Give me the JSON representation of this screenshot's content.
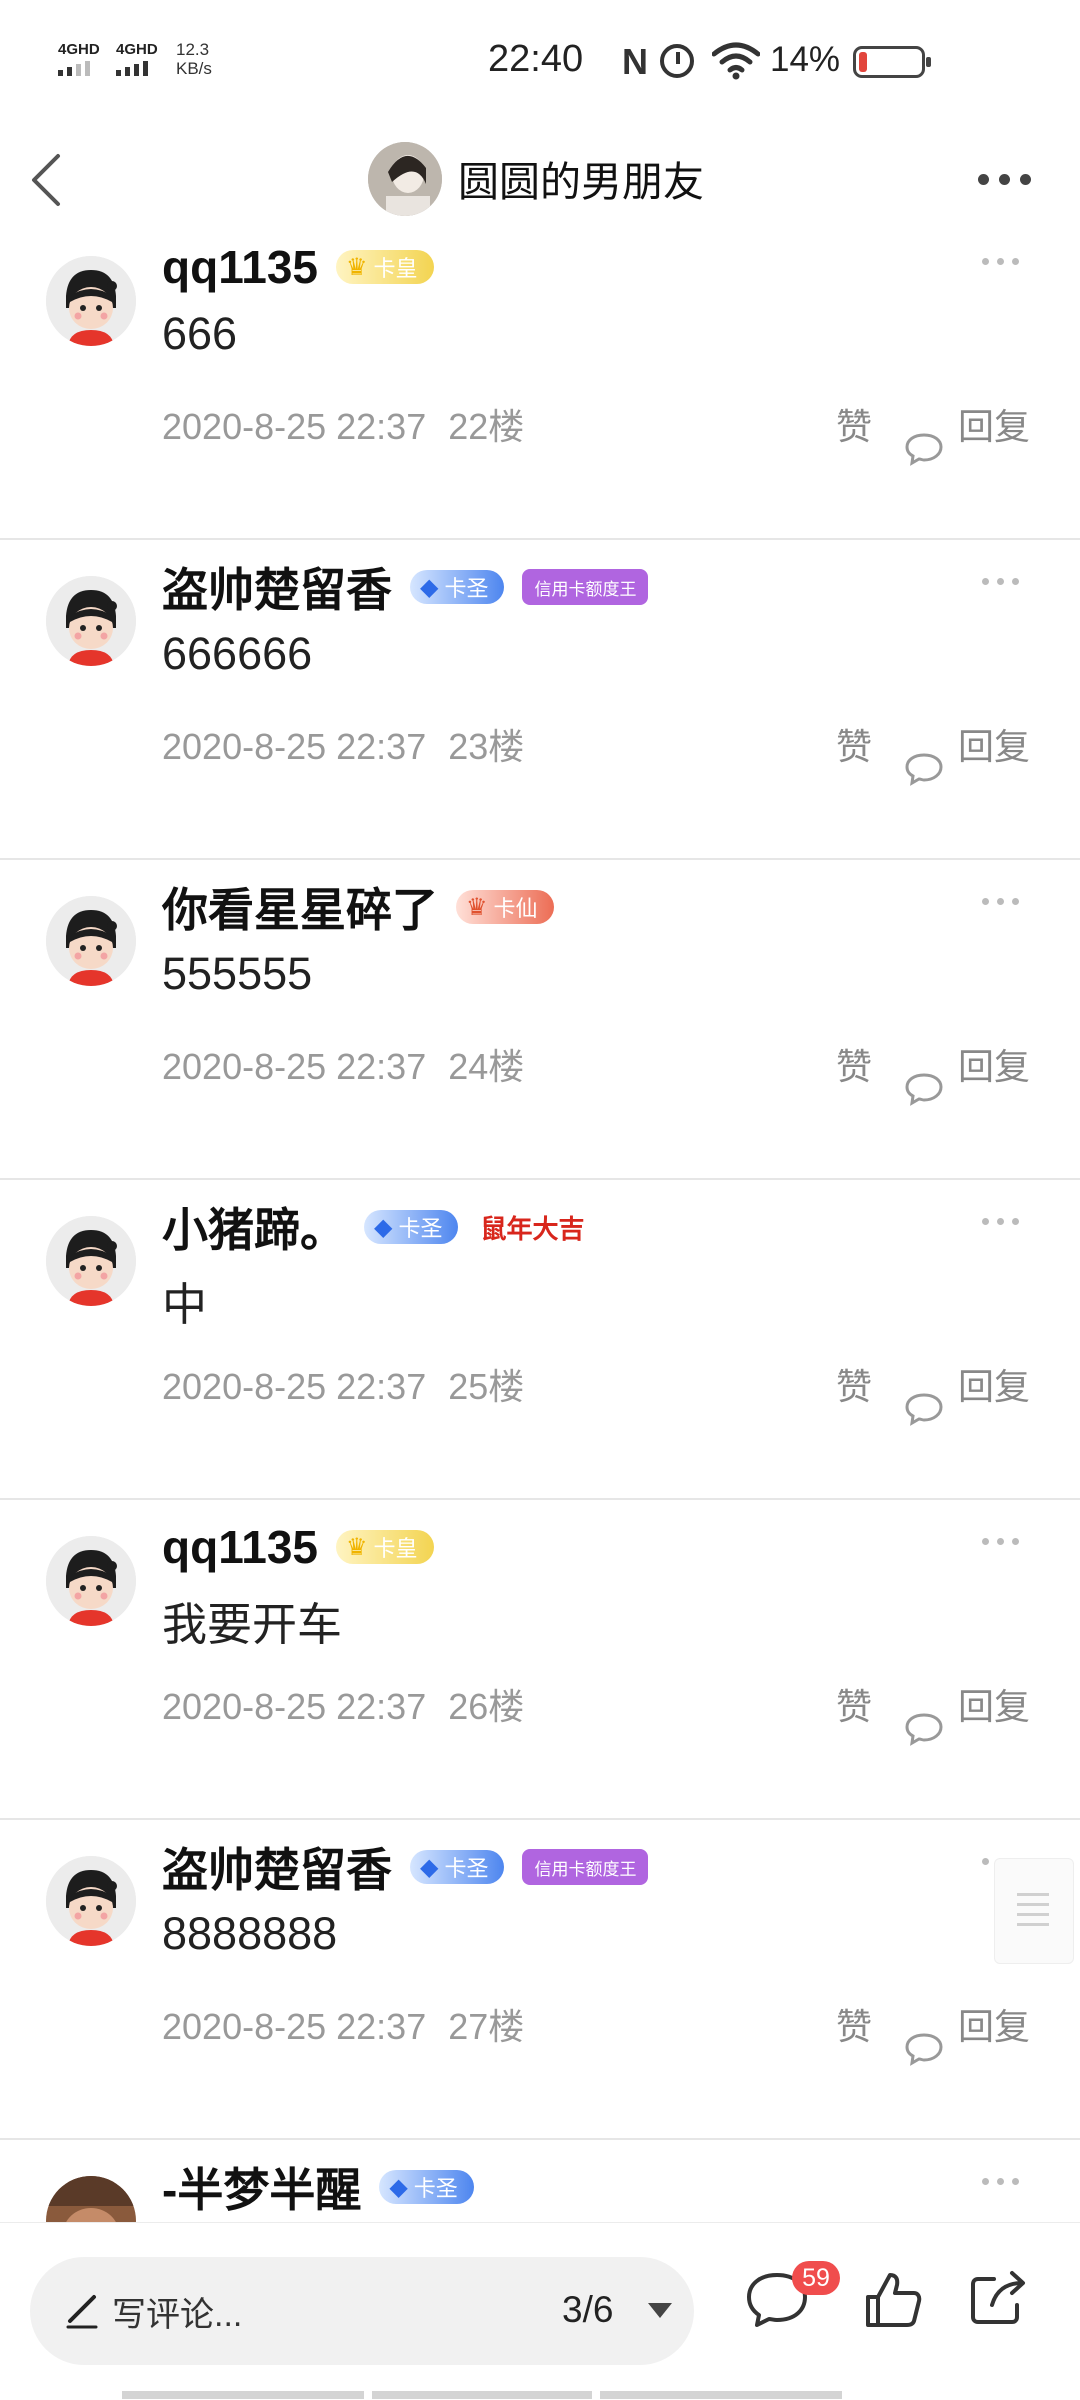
{
  "status_bar": {
    "sim1": "4GHD",
    "sim2": "4GHD",
    "net_speed_value": "12.3",
    "net_speed_unit": "KB/s",
    "time": "22:40",
    "battery": "14%",
    "battery_level": 0.14,
    "icons": [
      "nfc-icon",
      "alarm-icon",
      "wifi-icon",
      "battery-icon"
    ]
  },
  "header": {
    "back_icon": "chevron-left-icon",
    "title": "圆圆的男朋友",
    "more_icon": "more-dots-icon"
  },
  "comments": [
    {
      "name": "qq1135",
      "badges": [
        {
          "type": "gold",
          "icon": "♛",
          "label": "卡皇"
        }
      ],
      "text": "666",
      "date": "2020-8-25 22:37",
      "floor": "22楼",
      "avatar": "cartoon"
    },
    {
      "name": "盗帅楚留香",
      "badges": [
        {
          "type": "blue",
          "icon": "◆",
          "label": "卡圣"
        },
        {
          "type": "purple",
          "icon": "",
          "label": "信用卡额度王"
        }
      ],
      "text": "666666",
      "date": "2020-8-25 22:37",
      "floor": "23楼",
      "avatar": "cartoon"
    },
    {
      "name": "你看星星碎了",
      "badges": [
        {
          "type": "red",
          "icon": "♛",
          "label": "卡仙"
        }
      ],
      "text": "555555",
      "date": "2020-8-25 22:37",
      "floor": "24楼",
      "avatar": "cartoon"
    },
    {
      "name": "小猪蹄。",
      "badges": [
        {
          "type": "blue",
          "icon": "◆",
          "label": "卡圣"
        },
        {
          "type": "newyear",
          "icon": "",
          "label": "鼠年大吉"
        }
      ],
      "text": "中",
      "date": "2020-8-25 22:37",
      "floor": "25楼",
      "avatar": "cartoon"
    },
    {
      "name": "qq1135",
      "badges": [
        {
          "type": "gold",
          "icon": "♛",
          "label": "卡皇"
        }
      ],
      "text": "我要开车",
      "date": "2020-8-25 22:37",
      "floor": "26楼",
      "avatar": "cartoon"
    },
    {
      "name": "盗帅楚留香",
      "badges": [
        {
          "type": "blue",
          "icon": "◆",
          "label": "卡圣"
        },
        {
          "type": "purple",
          "icon": "",
          "label": "信用卡额度王"
        }
      ],
      "text": "8888888",
      "date": "2020-8-25 22:37",
      "floor": "27楼",
      "avatar": "cartoon"
    },
    {
      "name": "-半梦半醒",
      "badges": [
        {
          "type": "blue",
          "icon": "◆",
          "label": "卡圣"
        }
      ],
      "text": "",
      "date": "",
      "floor": "",
      "avatar": "photo"
    }
  ],
  "comment_actions": {
    "like_label": "赞",
    "reply_label": "回复"
  },
  "bottom_bar": {
    "placeholder": "写评论...",
    "page_indicator": "3/6",
    "comment_count": "59",
    "icons": [
      "pencil-icon",
      "caret-down-icon",
      "comment-icon",
      "thumbs-up-icon",
      "share-icon"
    ]
  }
}
